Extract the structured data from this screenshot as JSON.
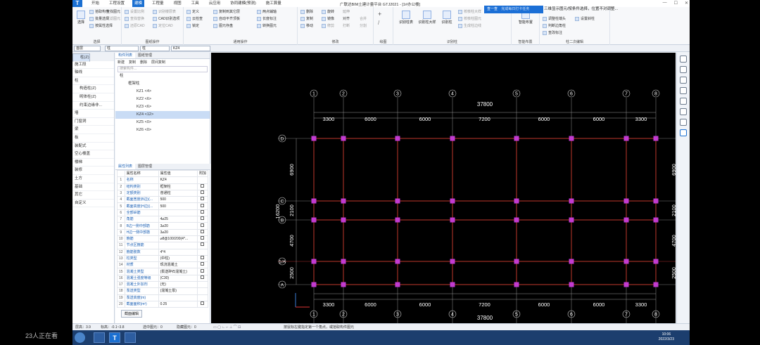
{
  "app": {
    "title": "广联达BIM土建计量平台 GTJ2021 - [1#办公楼]",
    "menus": [
      "开始",
      "工程设置",
      "建模",
      "工程量",
      "视图",
      "工具",
      "云应用",
      "协同建模(预测)",
      "施工算量"
    ],
    "active_menu": "建模",
    "notice_button": "查一查",
    "notice_text": "三维显示图元/按条件选择，位置不对调整...",
    "popup_hint": "完成每日打卡任务"
  },
  "ribbon": {
    "select_group": {
      "label": "选择",
      "big": "选择",
      "items": [
        "拾取构件",
        "批量选择",
        "按属性选择"
      ],
      "col2": [
        "查找图元",
        "过滤图元"
      ]
    },
    "cad_group": {
      "label": "图纸操作",
      "items": [
        "设置比例",
        "查找替换",
        "还原CAD",
        "识别楼层表",
        "CAD识别选项",
        "定位CAD"
      ]
    },
    "common_group": {
      "label": "通用操作",
      "items": [
        "定义",
        "复制到其它层",
        "两点辅轴",
        "云检查",
        "自动平齐顶板",
        "长度标注",
        "锁定",
        "图元存盘",
        "转换图元"
      ]
    },
    "modify_group": {
      "label": "修改",
      "items": [
        "删除",
        "旋转",
        "复制",
        "镜像",
        "对齐",
        "移动",
        "延伸",
        "修剪",
        "打断",
        "合并",
        "分割"
      ]
    },
    "draw_group": {
      "label": "绘图"
    },
    "recognize_group": {
      "label": "识别柱",
      "items": [
        "识别柱表",
        "识别柱大样",
        "识别柱",
        "校核柱大样",
        "校核柱图元",
        "生成柱边线"
      ]
    },
    "smart_group": {
      "label": "智能布置",
      "big": "智能布置"
    },
    "column_group": {
      "label": "柱二次编辑",
      "items": [
        "调整柱端头",
        "判断边角柱",
        "查改标注",
        "设置斜柱"
      ]
    }
  },
  "selectors": [
    "首层",
    "柱",
    "柱",
    "KZ4"
  ],
  "nav": {
    "title": "导航栏",
    "items": [
      {
        "label": "施工段",
        "sub": false,
        "sel": false
      },
      {
        "label": "轴线",
        "sub": false,
        "sel": false
      },
      {
        "label": "柱",
        "sub": false,
        "sel": false
      },
      {
        "label": "柱(Z)",
        "sub": true,
        "sel": true
      },
      {
        "label": "构造柱(Z)",
        "sub": true,
        "sel": false
      },
      {
        "label": "砌体柱(Z)",
        "sub": true,
        "sel": false
      },
      {
        "label": "约束边缘非...",
        "sub": true,
        "sel": false
      },
      {
        "label": "墙",
        "sub": false,
        "sel": false
      },
      {
        "label": "门窗洞",
        "sub": false,
        "sel": false
      },
      {
        "label": "梁",
        "sub": false,
        "sel": false
      },
      {
        "label": "板",
        "sub": false,
        "sel": false
      },
      {
        "label": "装配式",
        "sub": false,
        "sel": false
      },
      {
        "label": "空心楼盖",
        "sub": false,
        "sel": false
      },
      {
        "label": "楼梯",
        "sub": false,
        "sel": false
      },
      {
        "label": "装修",
        "sub": false,
        "sel": false
      },
      {
        "label": "土方",
        "sub": false,
        "sel": false
      },
      {
        "label": "基础",
        "sub": false,
        "sel": false
      },
      {
        "label": "其它",
        "sub": false,
        "sel": false
      },
      {
        "label": "自定义",
        "sub": false,
        "sel": false
      }
    ]
  },
  "component_list": {
    "tabs": [
      "构件列表",
      "图纸管理"
    ],
    "toolbar": [
      "新建",
      "复制",
      "删除",
      "层间复制"
    ],
    "search_placeholder": "搜索构件...",
    "tree": [
      {
        "label": "柱",
        "indent": 0,
        "hl": false
      },
      {
        "label": "框架柱",
        "indent": 1,
        "hl": false
      },
      {
        "label": "KZ1 <4>",
        "indent": 2,
        "hl": false
      },
      {
        "label": "KZ2 <6>",
        "indent": 2,
        "hl": false
      },
      {
        "label": "KZ3 <6>",
        "indent": 2,
        "hl": false
      },
      {
        "label": "KZ4 <12>",
        "indent": 2,
        "hl": true
      },
      {
        "label": "KZ5 <0>",
        "indent": 2,
        "hl": false
      },
      {
        "label": "KZ6 <0>",
        "indent": 2,
        "hl": false
      }
    ]
  },
  "properties": {
    "tabs": [
      "属性列表",
      "图层管理"
    ],
    "headers": [
      "属性名称",
      "属性值",
      "附加"
    ],
    "rows": [
      {
        "no": "1",
        "name": "名称",
        "value": "KZ4",
        "ck": false
      },
      {
        "no": "2",
        "name": "结构类别",
        "value": "框架柱",
        "ck": true
      },
      {
        "no": "3",
        "name": "定额类别",
        "value": "普通柱",
        "ck": true
      },
      {
        "no": "4",
        "name": "截面宽度(B边)(...",
        "value": "500",
        "ck": true
      },
      {
        "no": "5",
        "name": "截面高度(H边)(...",
        "value": "500",
        "ck": true
      },
      {
        "no": "6",
        "name": "全部纵筋",
        "value": "",
        "ck": true
      },
      {
        "no": "7",
        "name": "角筋",
        "value": "4⌀25",
        "ck": true
      },
      {
        "no": "8",
        "name": "B边一侧中部筋",
        "value": "3⌀20",
        "ck": true
      },
      {
        "no": "9",
        "name": "H边一侧中部筋",
        "value": "3⌀20",
        "ck": true
      },
      {
        "no": "10",
        "name": "箍筋",
        "value": "⌀8@100/200(4*...",
        "ck": true
      },
      {
        "no": "11",
        "name": "节点区箍筋",
        "value": "",
        "ck": true
      },
      {
        "no": "12",
        "name": "箍筋肢数",
        "value": "4*4",
        "ck": false
      },
      {
        "no": "13",
        "name": "柱类型",
        "value": "(中柱)",
        "ck": true
      },
      {
        "no": "14",
        "name": "材质",
        "value": "现浇混凝土",
        "ck": true
      },
      {
        "no": "15",
        "name": "混凝土类型",
        "value": "(泵送碎石混凝土)",
        "ck": true
      },
      {
        "no": "16",
        "name": "混凝土强度等级",
        "value": "(C30)",
        "ck": true
      },
      {
        "no": "17",
        "name": "混凝土外加剂",
        "value": "(无)",
        "ck": false
      },
      {
        "no": "18",
        "name": "泵送类型",
        "value": "(混凝土泵)",
        "ck": false
      },
      {
        "no": "19",
        "name": "泵送高度(m)",
        "value": "",
        "ck": false
      },
      {
        "no": "20",
        "name": "截面面积(m²)",
        "value": "0.25",
        "ck": true
      }
    ],
    "footer_button": "截面编辑"
  },
  "drawing": {
    "axes_x": [
      "1",
      "2",
      "3",
      "4",
      "5",
      "6",
      "7",
      "8"
    ],
    "axes_y": [
      "D",
      "C",
      "B",
      "1/A",
      "A"
    ],
    "dims_x": [
      "3300",
      "6000",
      "6000",
      "7200",
      "6000",
      "6000",
      "3300"
    ],
    "total_x": "37800",
    "dims_y_right": [
      "6900",
      "2100",
      "4700",
      "2500"
    ],
    "dims_y_left": [
      "6900",
      "2100",
      "4700",
      "2500"
    ],
    "total_y": "16200"
  },
  "status": {
    "floor_height": "层高：3.9",
    "elevation": "标高：-0.1~3.8",
    "selected": "选中图元：0",
    "hidden": "隐藏图元：0",
    "hint": "按鼠标左键指定第一个角点，或拾取构件图元"
  },
  "taskbar": {
    "time": "10:06",
    "date": "2022/3/23"
  },
  "watermark": "23人正在看"
}
